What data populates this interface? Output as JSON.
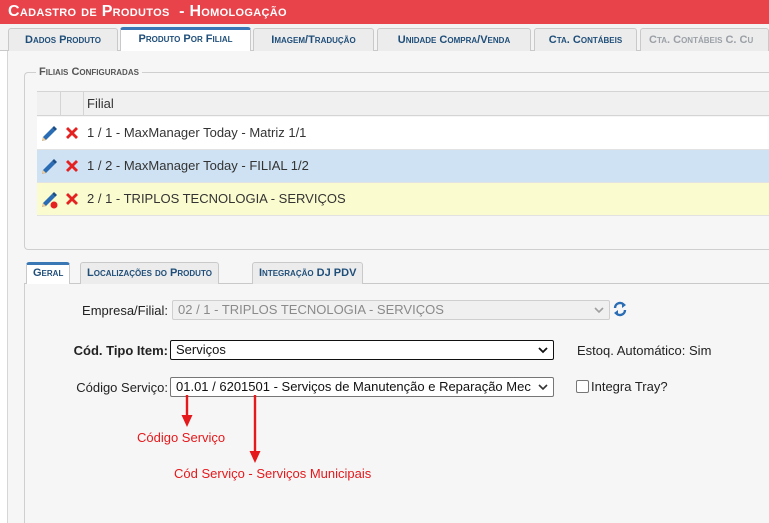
{
  "window": {
    "title": "Cadastro de Produtos  - Homologação"
  },
  "main_tabs": [
    {
      "label": "Dados Produto"
    },
    {
      "label": "Produto Por Filial"
    },
    {
      "label": "Imagem/Tradução"
    },
    {
      "label": "Unidade Compra/Venda"
    },
    {
      "label": "Cta. Contábeis"
    },
    {
      "label": "Cta. Contábeis C. Cu"
    }
  ],
  "filiais": {
    "legend": "Filiais Configuradas",
    "column_header": "Filial",
    "rows": [
      {
        "text": "1 / 1 - MaxManager Today - Matriz 1/1",
        "background": "#ffffff"
      },
      {
        "text": "1 / 2 - MaxManager Today - FILIAL 1/2",
        "background": "#cfe2f3"
      },
      {
        "text": "2 / 1 - TRIPLOS TECNOLOGIA - SERVIÇOS",
        "background": "#fbfbd0"
      }
    ]
  },
  "sub_tabs": [
    {
      "label": "Geral"
    },
    {
      "label": "Localizações do Produto"
    },
    {
      "label": "Integração DJ PDV"
    }
  ],
  "form": {
    "empresa_label": "Empresa/Filial:",
    "empresa_value": "02 / 1 - TRIPLOS TECNOLOGIA - SERVIÇOS",
    "tipo_item_label": "Cód. Tipo Item:",
    "tipo_item_value": "Serviços",
    "estoq_text": "Estoq. Automático: Sim",
    "codigo_servico_label": "Código Serviço:",
    "codigo_servico_value": "01.01 / 6201501 - Serviços de Manutenção e Reparação Mec",
    "integra_tray_label": "Integra Tray?"
  },
  "annotations": {
    "codigo_servico": "Código Serviço",
    "cod_servico_municipais": "Cód Serviço - Serviços Municipais"
  },
  "colors": {
    "title_bar": "#e8424a",
    "tab_text": "#1f4e79",
    "annotation": "#e5191c"
  }
}
